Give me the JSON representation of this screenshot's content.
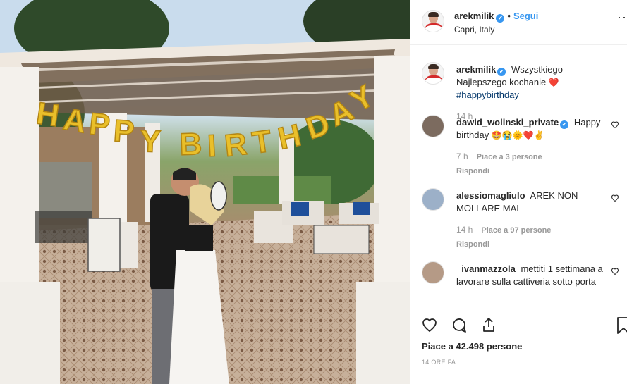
{
  "post": {
    "username": "arekmilik",
    "verified_glyph": "✔",
    "dot": "•",
    "follow_label": "Segui",
    "location": "Capri, Italy",
    "more_icon": "··"
  },
  "photo": {
    "banner_text": "HAPPY BIRTHDAY"
  },
  "comments": [
    {
      "user": "arekmilik",
      "verified": true,
      "text": "Wszystkiego Najlepszego kochanie",
      "emoji": "❤️",
      "hashtag": "#happybirthday",
      "time": "14 h"
    },
    {
      "user": "dawid_wolinski_private",
      "verified": true,
      "text": "Happy birthday",
      "emoji": "🤩😭🌞❤️✌",
      "time": "7 h",
      "likes": "Piace a 3 persone",
      "reply": "Rispondi"
    },
    {
      "user": "alessiomagliulo",
      "text": "AREK NON MOLLARE MAI",
      "time": "14 h",
      "likes": "Piace a 97 persone",
      "reply": "Rispondi"
    },
    {
      "user": "_ivanmazzola",
      "text": "mettiti 1 settimana a lavorare sulla cattiveria sotto porta"
    }
  ],
  "actions": {
    "like_icon": "heart-icon",
    "comment_icon": "comment-icon",
    "share_icon": "share-icon",
    "save_icon": "bookmark-icon",
    "likes_text": "Piace a 42.498 persone",
    "timestamp": "14 ORE FA"
  },
  "colors": {
    "link": "#3897f0",
    "hashtag": "#003569",
    "heart": "#ed4956"
  }
}
